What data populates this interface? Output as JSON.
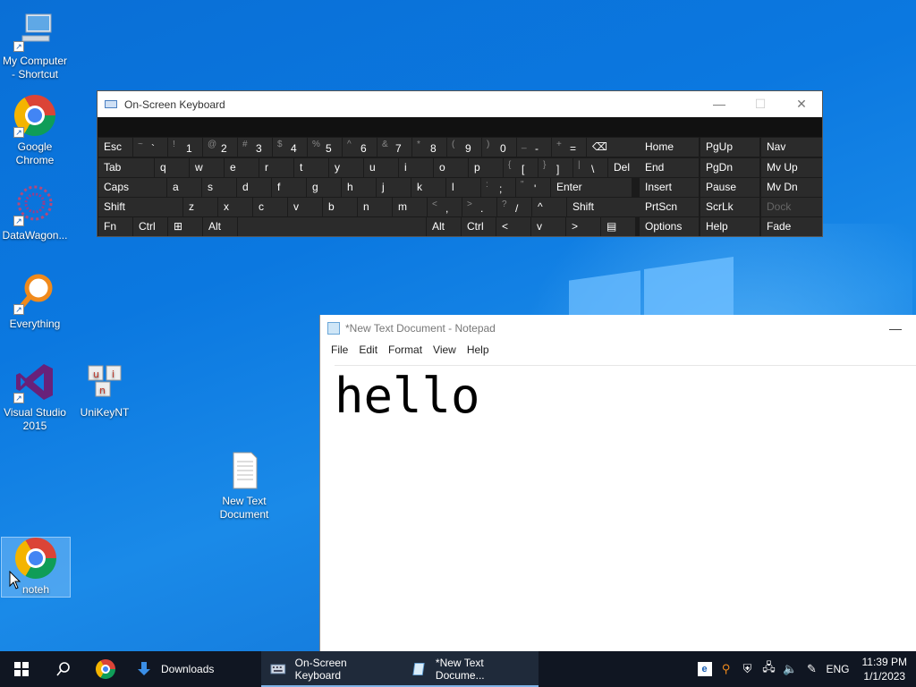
{
  "desktop": {
    "icons": [
      {
        "label": "My Computer - Shortcut",
        "icon": "computer-icon"
      },
      {
        "label": "Google Chrome",
        "icon": "chrome-icon"
      },
      {
        "label": "DataWagon...",
        "icon": "datawagon-icon"
      },
      {
        "label": "Everything",
        "icon": "search-magnifier-icon"
      },
      {
        "label": "Visual Studio 2015",
        "icon": "visual-studio-icon"
      },
      {
        "label": "UniKeyNT",
        "icon": "unikey-icon"
      },
      {
        "label": "New Text Document",
        "icon": "text-document-icon"
      },
      {
        "label": "noteh",
        "icon": "chrome-icon"
      }
    ]
  },
  "osk": {
    "title": "On-Screen Keyboard",
    "rows": [
      [
        "Esc",
        "~ `",
        "! 1",
        "@ 2",
        "# 3",
        "$ 4",
        "% 5",
        "^ 6",
        "& 7",
        "* 8",
        "( 9",
        ") 0",
        "_ -",
        "+ =",
        "⌫"
      ],
      [
        "Tab",
        "q",
        "w",
        "e",
        "r",
        "t",
        "y",
        "u",
        "i",
        "o",
        "p",
        "{ [",
        "} ]",
        "| \\",
        "Del"
      ],
      [
        "Caps",
        "a",
        "s",
        "d",
        "f",
        "g",
        "h",
        "j",
        "k",
        "l",
        ": ;",
        "\" '",
        "Enter"
      ],
      [
        "Shift",
        "z",
        "x",
        "c",
        "v",
        "b",
        "n",
        "m",
        "< ,",
        "> .",
        "? /",
        "^",
        "Shift"
      ],
      [
        "Fn",
        "Ctrl",
        "⊞",
        "Alt",
        "",
        "Alt",
        "Ctrl",
        "<",
        "v",
        ">",
        "▤"
      ]
    ],
    "nav_rows": [
      [
        "Home",
        "PgUp",
        "Nav"
      ],
      [
        "End",
        "PgDn",
        "Mv Up"
      ],
      [
        "Insert",
        "Pause",
        "Mv Dn"
      ],
      [
        "PrtScn",
        "ScrLk",
        "Dock"
      ],
      [
        "Options",
        "Help",
        "Fade"
      ]
    ]
  },
  "notepad": {
    "title": "*New Text Document - Notepad",
    "menu": [
      "File",
      "Edit",
      "Format",
      "View",
      "Help"
    ],
    "content": "hello"
  },
  "taskbar": {
    "apps": [
      {
        "label": "Downloads"
      },
      {
        "label": "On-Screen Keyboard"
      },
      {
        "label": "*New Text Docume..."
      }
    ],
    "language": "ENG",
    "time": "11:39 PM",
    "date": "1/1/2023"
  }
}
